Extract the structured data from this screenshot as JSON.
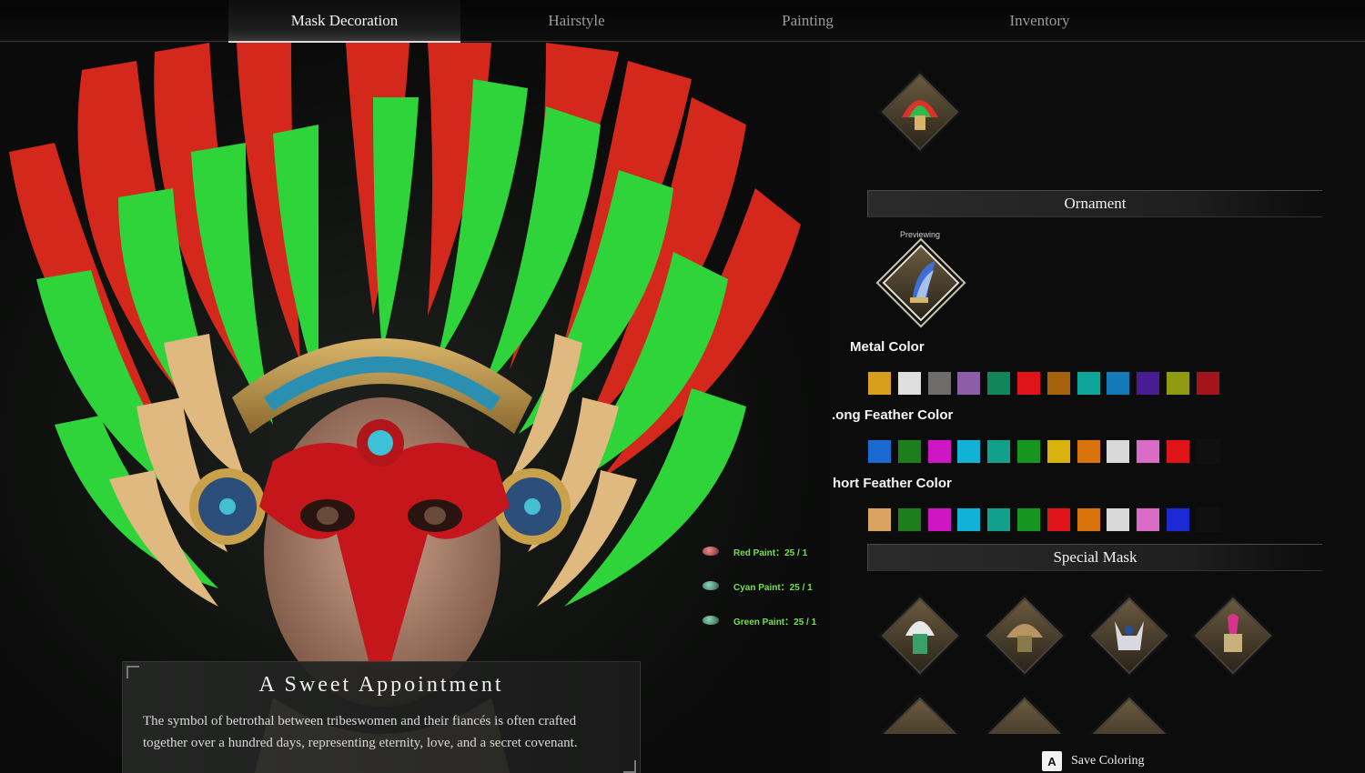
{
  "tabs": [
    {
      "label": "Mask Decoration",
      "active": true
    },
    {
      "label": "Hairstyle",
      "active": false
    },
    {
      "label": "Painting",
      "active": false
    },
    {
      "label": "Inventory",
      "active": false
    }
  ],
  "paints": [
    {
      "label": "Red Paint：25 / 1",
      "kind": "red"
    },
    {
      "label": "Cyan Paint：25 / 1",
      "kind": "cyan"
    },
    {
      "label": "Green Paint：25 / 1",
      "kind": "green"
    }
  ],
  "description": {
    "title": "A Sweet Appointment",
    "text": "The symbol of betrothal between tribeswomen and their fiancés is often crafted together over a hundred days, representing eternity, love, and a secret covenant."
  },
  "panel": {
    "ornament_header": "Ornament",
    "previewing_label": "Previewing",
    "special_mask_header": "Special Mask",
    "icons": {
      "mask_slot": "feather-headdress-icon",
      "ornament_slot": "blue-feather-ornament-icon",
      "special_masks": [
        "white-feather-mask-icon",
        "tan-feather-mask-icon",
        "horned-skull-mask-icon",
        "pink-crest-mask-icon"
      ]
    },
    "metal_color": {
      "label": "Metal Color",
      "swatches": [
        "#d89f1d",
        "#dedede",
        "#6e6c6a",
        "#8c5ea8",
        "#13855a",
        "#de1418",
        "#a8620c",
        "#0fa59a",
        "#127ab6",
        "#4a1c92",
        "#8f9a11",
        "#a3151b"
      ]
    },
    "long_feather_color": {
      "label": ".ong Feather Color",
      "swatches": [
        "#1a6ad2",
        "#1d7f1c",
        "#ce16c4",
        "#12b1d6",
        "#13a08a",
        "#169520",
        "#d9b20d",
        "#d9740c",
        "#d9d9d9",
        "#d86cc6",
        "#de1418",
        "#101010"
      ]
    },
    "short_feather_color": {
      "label": "hort Feather Color",
      "swatches": [
        "#d9a461",
        "#1d7f1c",
        "#ce16c4",
        "#12b1d6",
        "#13a08a",
        "#169520",
        "#de1418",
        "#d9740c",
        "#d9d9d9",
        "#d86cc6",
        "#1c2ad6",
        "#101010"
      ]
    }
  },
  "save": {
    "key": "A",
    "label": "Save Coloring"
  }
}
